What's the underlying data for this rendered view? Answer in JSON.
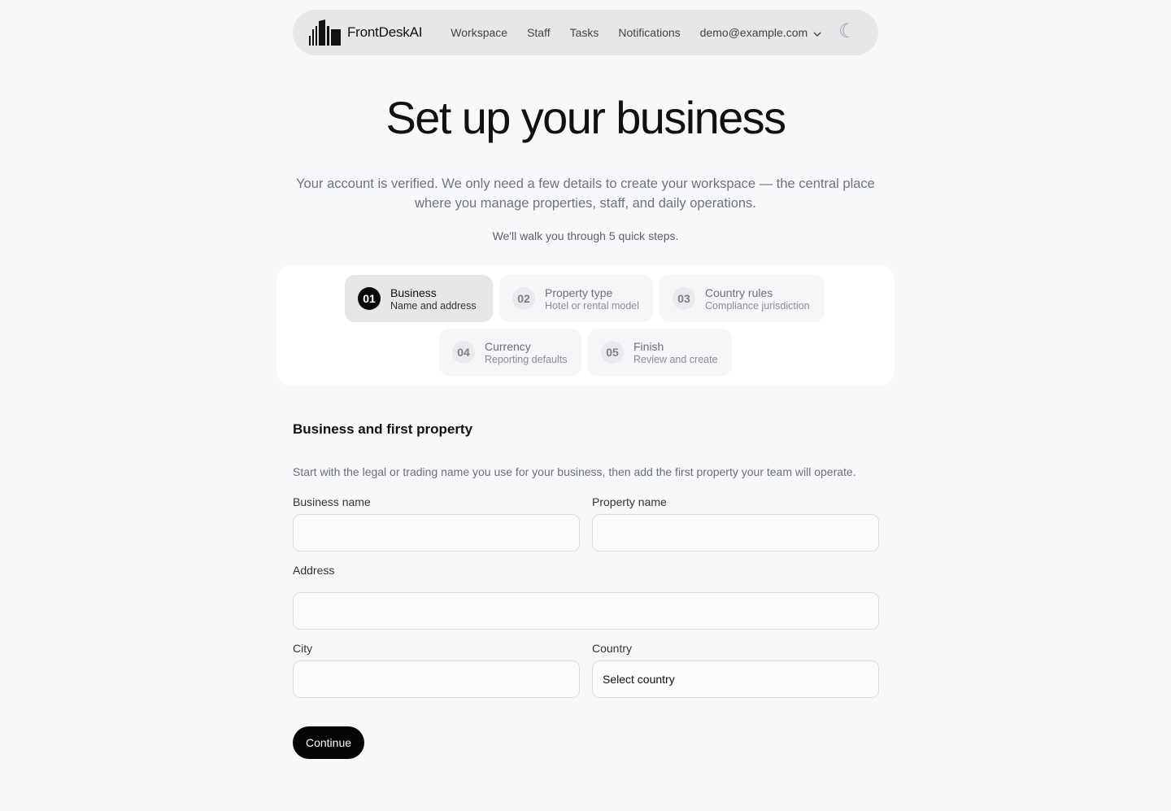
{
  "nav": {
    "brand": "FrontDeskAI",
    "links": [
      "Workspace",
      "Staff",
      "Tasks",
      "Notifications"
    ],
    "account": "demo@example.com",
    "theme_icon": "moon-icon"
  },
  "hero": {
    "title": "Set up your business",
    "subtitle": "Your account is verified. We only need a few details to create your workspace — the central place where you manage properties, staff, and daily operations.",
    "steps_note": "We'll walk you through 5 quick steps."
  },
  "steps": [
    {
      "num": "01",
      "title": "Business",
      "sub": "Name and address",
      "active": true
    },
    {
      "num": "02",
      "title": "Property type",
      "sub": "Hotel or rental model",
      "active": false
    },
    {
      "num": "03",
      "title": "Country rules",
      "sub": "Compliance jurisdiction",
      "active": false
    },
    {
      "num": "04",
      "title": "Currency",
      "sub": "Reporting defaults",
      "active": false
    },
    {
      "num": "05",
      "title": "Finish",
      "sub": "Review and create",
      "active": false
    }
  ],
  "form": {
    "section_title": "Business and first property",
    "section_desc": "Start with the legal or trading name you use for your business, then add the first property your team will operate.",
    "business_name_label": "Business name",
    "business_name_value": "",
    "property_name_label": "Property name",
    "property_name_value": "",
    "address_label": "Address",
    "address_value": "",
    "city_label": "City",
    "city_value": "",
    "country_label": "Country",
    "country_value": "Select country",
    "continue_label": "Continue"
  },
  "colors": {
    "background": "#f7f8fa",
    "nav_background": "#e6e7e9",
    "primary_button": "#050505",
    "active_step": "#e5e6e8"
  }
}
